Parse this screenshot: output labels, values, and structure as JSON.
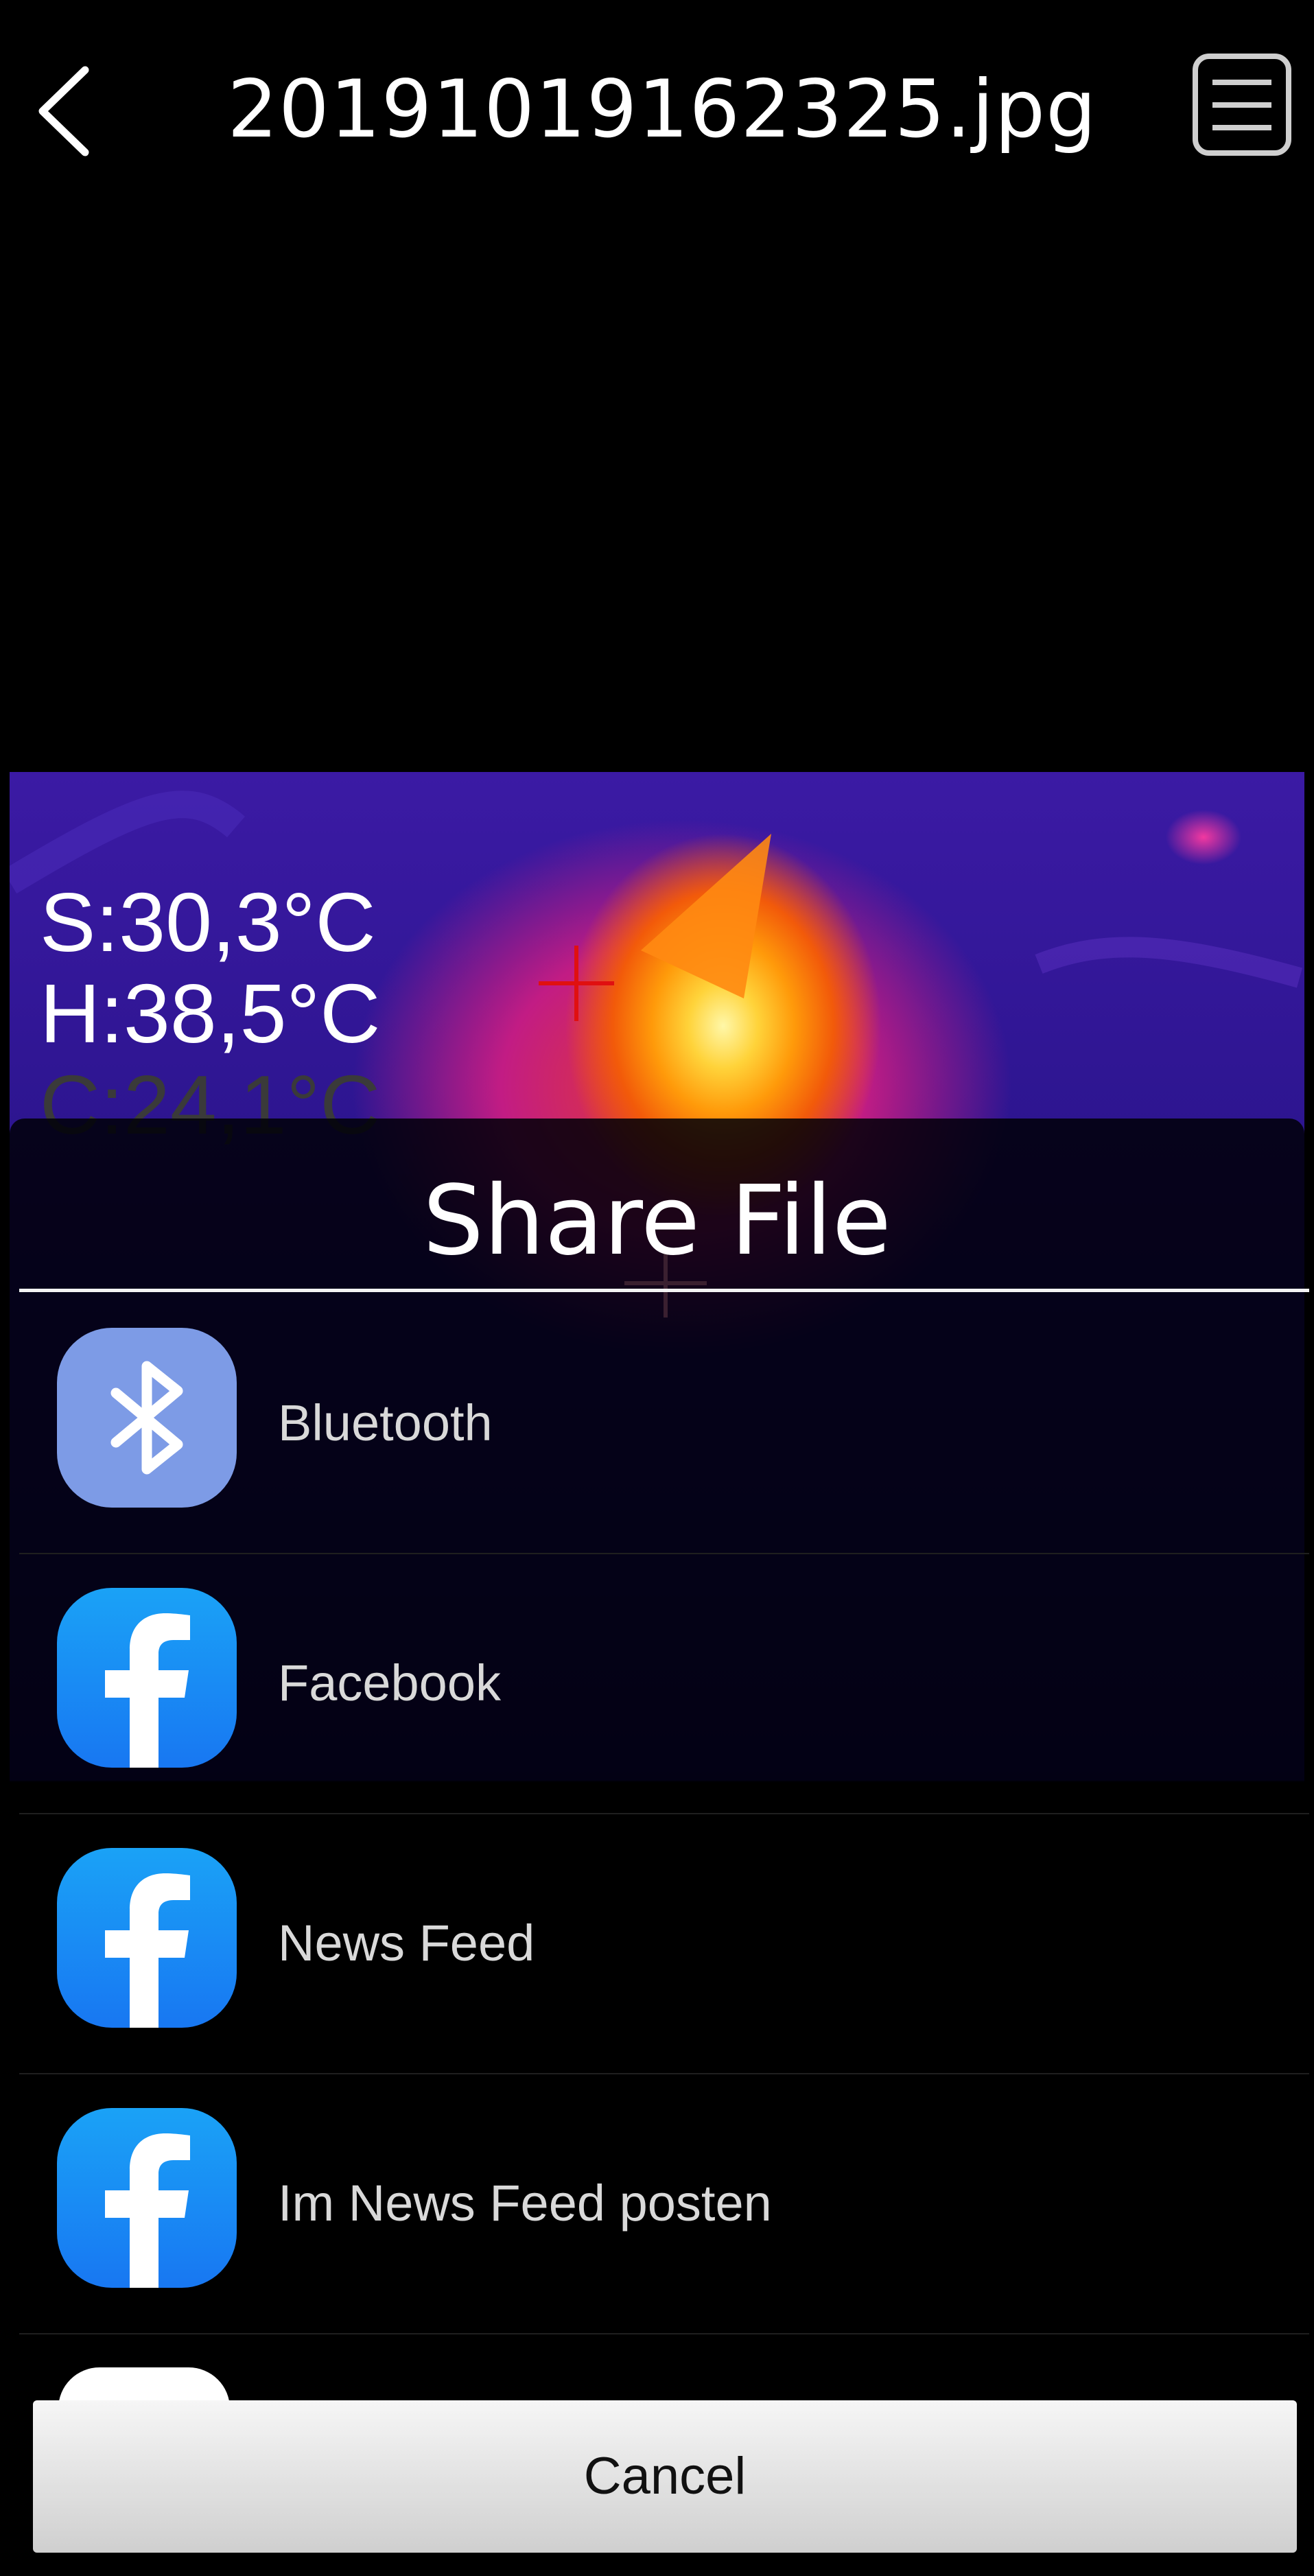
{
  "header": {
    "title": "20191019162325.jpg",
    "back_icon": "chevron-left-icon",
    "menu_icon": "list-menu-icon"
  },
  "thermal": {
    "readings": {
      "s": "S:30,3°C",
      "h": "H:38,5°C",
      "c": "C:24,1°C"
    },
    "colors": {
      "hot": "#ffd33a",
      "warm": "#f25a0a",
      "mid": "#c21c84",
      "cold": "#2d1590",
      "crosshair": "#e01010"
    }
  },
  "share_sheet": {
    "title": "Share File",
    "items": [
      {
        "label": "Bluetooth",
        "icon": "bluetooth-icon",
        "color": "#7d9be6"
      },
      {
        "label": "Facebook",
        "icon": "facebook-icon",
        "color": "#1877f2"
      },
      {
        "label": "News Feed",
        "icon": "facebook-icon",
        "color": "#1877f2"
      },
      {
        "label": "Im News Feed posten",
        "icon": "facebook-icon",
        "color": "#1877f2"
      }
    ],
    "cancel_label": "Cancel"
  }
}
